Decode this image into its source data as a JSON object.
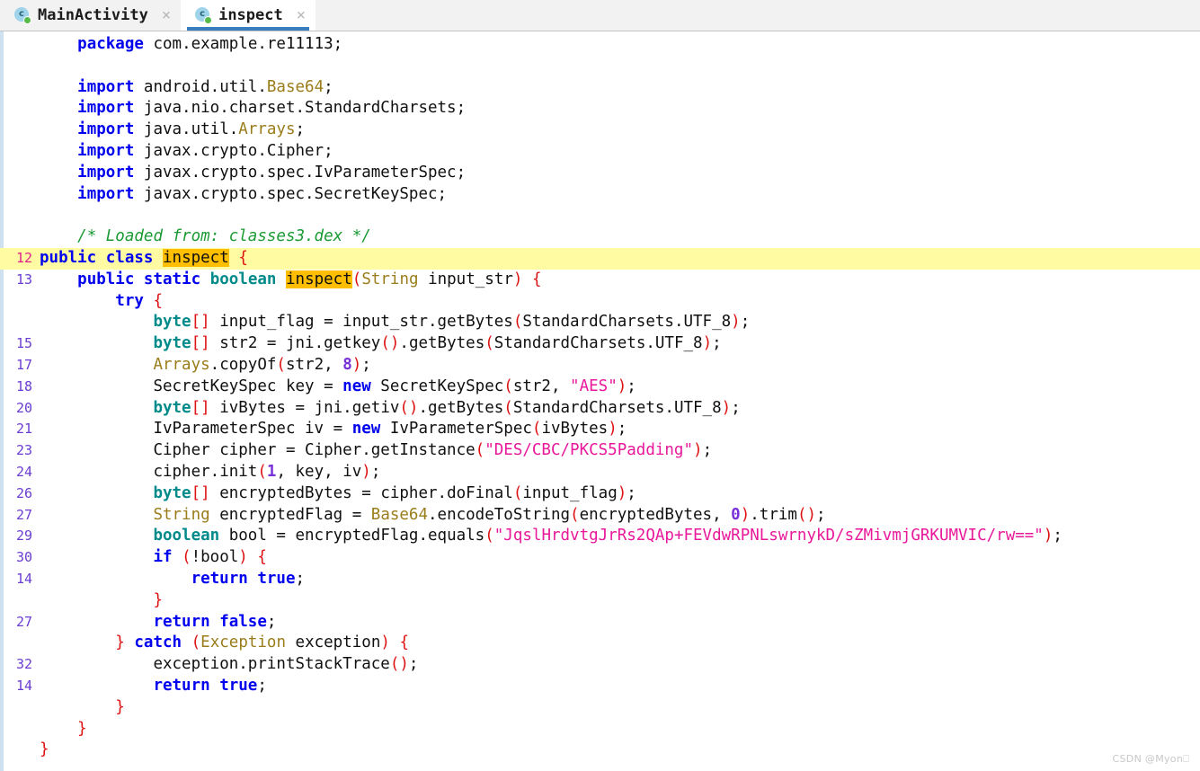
{
  "tabs": [
    {
      "label": "MainActivity",
      "icon": "java-class-icon",
      "close": "×",
      "active": false
    },
    {
      "label": "inspect",
      "icon": "java-class-icon",
      "close": "×",
      "active": true
    }
  ],
  "editor": {
    "highlighted_line_number": "12",
    "occurrence_term": "inspect",
    "watermark": "CSDN @Myon⎕",
    "lines": [
      {
        "num": "",
        "hl": false,
        "tokens": [
          {
            "t": "    ",
            "c": "id"
          },
          {
            "t": "package",
            "c": "kw"
          },
          {
            "t": " com.example.re11113",
            "c": "id"
          },
          {
            "t": ";",
            "c": "id"
          }
        ]
      },
      {
        "num": "",
        "hl": false,
        "tokens": []
      },
      {
        "num": "",
        "hl": false,
        "tokens": [
          {
            "t": "    ",
            "c": "id"
          },
          {
            "t": "import",
            "c": "kw"
          },
          {
            "t": " android.util.",
            "c": "id"
          },
          {
            "t": "Base64",
            "c": "cls"
          },
          {
            "t": ";",
            "c": "id"
          }
        ]
      },
      {
        "num": "",
        "hl": false,
        "tokens": [
          {
            "t": "    ",
            "c": "id"
          },
          {
            "t": "import",
            "c": "kw"
          },
          {
            "t": " java.nio.charset.StandardCharsets;",
            "c": "id"
          }
        ]
      },
      {
        "num": "",
        "hl": false,
        "tokens": [
          {
            "t": "    ",
            "c": "id"
          },
          {
            "t": "import",
            "c": "kw"
          },
          {
            "t": " java.util.",
            "c": "id"
          },
          {
            "t": "Arrays",
            "c": "cls"
          },
          {
            "t": ";",
            "c": "id"
          }
        ]
      },
      {
        "num": "",
        "hl": false,
        "tokens": [
          {
            "t": "    ",
            "c": "id"
          },
          {
            "t": "import",
            "c": "kw"
          },
          {
            "t": " javax.crypto.Cipher;",
            "c": "id"
          }
        ]
      },
      {
        "num": "",
        "hl": false,
        "tokens": [
          {
            "t": "    ",
            "c": "id"
          },
          {
            "t": "import",
            "c": "kw"
          },
          {
            "t": " javax.crypto.spec.IvParameterSpec;",
            "c": "id"
          }
        ]
      },
      {
        "num": "",
        "hl": false,
        "tokens": [
          {
            "t": "    ",
            "c": "id"
          },
          {
            "t": "import",
            "c": "kw"
          },
          {
            "t": " javax.crypto.spec.SecretKeySpec;",
            "c": "id"
          }
        ]
      },
      {
        "num": "",
        "hl": false,
        "tokens": []
      },
      {
        "num": "",
        "hl": false,
        "tokens": [
          {
            "t": "    ",
            "c": "id"
          },
          {
            "t": "/* Loaded from: classes3.dex */",
            "c": "cmt"
          }
        ]
      },
      {
        "num": "12",
        "hl": true,
        "tokens": [
          {
            "t": "public",
            "c": "kw"
          },
          {
            "t": " ",
            "c": "id"
          },
          {
            "t": "class",
            "c": "kw"
          },
          {
            "t": " ",
            "c": "id"
          },
          {
            "t": "|",
            "c": "caret"
          },
          {
            "t": "inspect",
            "c": "mark"
          },
          {
            "t": " ",
            "c": "id"
          },
          {
            "t": "{",
            "c": "pun"
          }
        ],
        "noindent": true
      },
      {
        "num": "13",
        "hl": false,
        "tokens": [
          {
            "t": "    ",
            "c": "id"
          },
          {
            "t": "public",
            "c": "kw"
          },
          {
            "t": " ",
            "c": "id"
          },
          {
            "t": "static",
            "c": "kw"
          },
          {
            "t": " ",
            "c": "id"
          },
          {
            "t": "boolean",
            "c": "typ"
          },
          {
            "t": " ",
            "c": "id"
          },
          {
            "t": "inspect",
            "c": "mark"
          },
          {
            "t": "(",
            "c": "pun"
          },
          {
            "t": "String",
            "c": "cls"
          },
          {
            "t": " input_str",
            "c": "id"
          },
          {
            "t": ")",
            "c": "pun"
          },
          {
            "t": " ",
            "c": "id"
          },
          {
            "t": "{",
            "c": "pun"
          }
        ]
      },
      {
        "num": "",
        "hl": false,
        "tokens": [
          {
            "t": "        ",
            "c": "id"
          },
          {
            "t": "try",
            "c": "kw"
          },
          {
            "t": " ",
            "c": "id"
          },
          {
            "t": "{",
            "c": "pun"
          }
        ]
      },
      {
        "num": "",
        "hl": false,
        "tokens": [
          {
            "t": "            ",
            "c": "id"
          },
          {
            "t": "byte",
            "c": "typ"
          },
          {
            "t": "[]",
            "c": "pun"
          },
          {
            "t": " input_flag = input_str.getBytes",
            "c": "id"
          },
          {
            "t": "(",
            "c": "pun"
          },
          {
            "t": "StandardCharsets.UTF_8",
            "c": "id"
          },
          {
            "t": ")",
            "c": "pun"
          },
          {
            "t": ";",
            "c": "id"
          }
        ]
      },
      {
        "num": "15",
        "hl": false,
        "tokens": [
          {
            "t": "            ",
            "c": "id"
          },
          {
            "t": "byte",
            "c": "typ"
          },
          {
            "t": "[]",
            "c": "pun"
          },
          {
            "t": " str2 = jni.getkey",
            "c": "id"
          },
          {
            "t": "()",
            "c": "pun"
          },
          {
            "t": ".getBytes",
            "c": "id"
          },
          {
            "t": "(",
            "c": "pun"
          },
          {
            "t": "StandardCharsets.UTF_8",
            "c": "id"
          },
          {
            "t": ")",
            "c": "pun"
          },
          {
            "t": ";",
            "c": "id"
          }
        ]
      },
      {
        "num": "17",
        "hl": false,
        "tokens": [
          {
            "t": "            ",
            "c": "id"
          },
          {
            "t": "Arrays",
            "c": "cls"
          },
          {
            "t": ".copyOf",
            "c": "id"
          },
          {
            "t": "(",
            "c": "pun"
          },
          {
            "t": "str2, ",
            "c": "id"
          },
          {
            "t": "8",
            "c": "num"
          },
          {
            "t": ")",
            "c": "pun"
          },
          {
            "t": ";",
            "c": "id"
          }
        ]
      },
      {
        "num": "18",
        "hl": false,
        "tokens": [
          {
            "t": "            ",
            "c": "id"
          },
          {
            "t": "SecretKeySpec key = ",
            "c": "id"
          },
          {
            "t": "new",
            "c": "kw"
          },
          {
            "t": " SecretKeySpec",
            "c": "id"
          },
          {
            "t": "(",
            "c": "pun"
          },
          {
            "t": "str2, ",
            "c": "id"
          },
          {
            "t": "\"AES\"",
            "c": "str"
          },
          {
            "t": ")",
            "c": "pun"
          },
          {
            "t": ";",
            "c": "id"
          }
        ]
      },
      {
        "num": "20",
        "hl": false,
        "tokens": [
          {
            "t": "            ",
            "c": "id"
          },
          {
            "t": "byte",
            "c": "typ"
          },
          {
            "t": "[]",
            "c": "pun"
          },
          {
            "t": " ivBytes = jni.getiv",
            "c": "id"
          },
          {
            "t": "()",
            "c": "pun"
          },
          {
            "t": ".getBytes",
            "c": "id"
          },
          {
            "t": "(",
            "c": "pun"
          },
          {
            "t": "StandardCharsets.UTF_8",
            "c": "id"
          },
          {
            "t": ")",
            "c": "pun"
          },
          {
            "t": ";",
            "c": "id"
          }
        ]
      },
      {
        "num": "21",
        "hl": false,
        "tokens": [
          {
            "t": "            ",
            "c": "id"
          },
          {
            "t": "IvParameterSpec iv = ",
            "c": "id"
          },
          {
            "t": "new",
            "c": "kw"
          },
          {
            "t": " IvParameterSpec",
            "c": "id"
          },
          {
            "t": "(",
            "c": "pun"
          },
          {
            "t": "ivBytes",
            "c": "id"
          },
          {
            "t": ")",
            "c": "pun"
          },
          {
            "t": ";",
            "c": "id"
          }
        ]
      },
      {
        "num": "23",
        "hl": false,
        "tokens": [
          {
            "t": "            ",
            "c": "id"
          },
          {
            "t": "Cipher cipher = Cipher.getInstance",
            "c": "id"
          },
          {
            "t": "(",
            "c": "pun"
          },
          {
            "t": "\"DES/CBC/PKCS5Padding\"",
            "c": "str"
          },
          {
            "t": ")",
            "c": "pun"
          },
          {
            "t": ";",
            "c": "id"
          }
        ]
      },
      {
        "num": "24",
        "hl": false,
        "tokens": [
          {
            "t": "            ",
            "c": "id"
          },
          {
            "t": "cipher.init",
            "c": "id"
          },
          {
            "t": "(",
            "c": "pun"
          },
          {
            "t": "1",
            "c": "num"
          },
          {
            "t": ", key, iv",
            "c": "id"
          },
          {
            "t": ")",
            "c": "pun"
          },
          {
            "t": ";",
            "c": "id"
          }
        ]
      },
      {
        "num": "26",
        "hl": false,
        "tokens": [
          {
            "t": "            ",
            "c": "id"
          },
          {
            "t": "byte",
            "c": "typ"
          },
          {
            "t": "[]",
            "c": "pun"
          },
          {
            "t": " encryptedBytes = cipher.doFinal",
            "c": "id"
          },
          {
            "t": "(",
            "c": "pun"
          },
          {
            "t": "input_flag",
            "c": "id"
          },
          {
            "t": ")",
            "c": "pun"
          },
          {
            "t": ";",
            "c": "id"
          }
        ]
      },
      {
        "num": "27",
        "hl": false,
        "tokens": [
          {
            "t": "            ",
            "c": "id"
          },
          {
            "t": "String",
            "c": "cls"
          },
          {
            "t": " encryptedFlag = ",
            "c": "id"
          },
          {
            "t": "Base64",
            "c": "cls"
          },
          {
            "t": ".encodeToString",
            "c": "id"
          },
          {
            "t": "(",
            "c": "pun"
          },
          {
            "t": "encryptedBytes, ",
            "c": "id"
          },
          {
            "t": "0",
            "c": "num"
          },
          {
            "t": ")",
            "c": "pun"
          },
          {
            "t": ".trim",
            "c": "id"
          },
          {
            "t": "()",
            "c": "pun"
          },
          {
            "t": ";",
            "c": "id"
          }
        ]
      },
      {
        "num": "29",
        "hl": false,
        "tokens": [
          {
            "t": "            ",
            "c": "id"
          },
          {
            "t": "boolean",
            "c": "typ"
          },
          {
            "t": " bool = encryptedFlag.equals",
            "c": "id"
          },
          {
            "t": "(",
            "c": "pun"
          },
          {
            "t": "\"JqslHrdvtgJrRs2QAp+FEVdwRPNLswrnykD/sZMivmjGRKUMVIC/rw==\"",
            "c": "str"
          },
          {
            "t": ")",
            "c": "pun"
          },
          {
            "t": ";",
            "c": "id"
          }
        ]
      },
      {
        "num": "30",
        "hl": false,
        "tokens": [
          {
            "t": "            ",
            "c": "id"
          },
          {
            "t": "if",
            "c": "kw"
          },
          {
            "t": " ",
            "c": "id"
          },
          {
            "t": "(",
            "c": "pun"
          },
          {
            "t": "!bool",
            "c": "id"
          },
          {
            "t": ")",
            "c": "pun"
          },
          {
            "t": " ",
            "c": "id"
          },
          {
            "t": "{",
            "c": "pun"
          }
        ]
      },
      {
        "num": "14",
        "hl": false,
        "tokens": [
          {
            "t": "                ",
            "c": "id"
          },
          {
            "t": "return",
            "c": "kw"
          },
          {
            "t": " ",
            "c": "id"
          },
          {
            "t": "true",
            "c": "kw"
          },
          {
            "t": ";",
            "c": "id"
          }
        ]
      },
      {
        "num": "",
        "hl": false,
        "tokens": [
          {
            "t": "            ",
            "c": "id"
          },
          {
            "t": "}",
            "c": "pun"
          }
        ]
      },
      {
        "num": "27",
        "hl": false,
        "tokens": [
          {
            "t": "            ",
            "c": "id"
          },
          {
            "t": "return",
            "c": "kw"
          },
          {
            "t": " ",
            "c": "id"
          },
          {
            "t": "false",
            "c": "kw"
          },
          {
            "t": ";",
            "c": "id"
          }
        ]
      },
      {
        "num": "",
        "hl": false,
        "tokens": [
          {
            "t": "        ",
            "c": "id"
          },
          {
            "t": "}",
            "c": "pun"
          },
          {
            "t": " ",
            "c": "id"
          },
          {
            "t": "catch",
            "c": "kw"
          },
          {
            "t": " ",
            "c": "id"
          },
          {
            "t": "(",
            "c": "pun"
          },
          {
            "t": "Exception",
            "c": "cls"
          },
          {
            "t": " exception",
            "c": "id"
          },
          {
            "t": ")",
            "c": "pun"
          },
          {
            "t": " ",
            "c": "id"
          },
          {
            "t": "{",
            "c": "pun"
          }
        ]
      },
      {
        "num": "32",
        "hl": false,
        "tokens": [
          {
            "t": "            ",
            "c": "id"
          },
          {
            "t": "exception.printStackTrace",
            "c": "id"
          },
          {
            "t": "()",
            "c": "pun"
          },
          {
            "t": ";",
            "c": "id"
          }
        ]
      },
      {
        "num": "14",
        "hl": false,
        "tokens": [
          {
            "t": "            ",
            "c": "id"
          },
          {
            "t": "return",
            "c": "kw"
          },
          {
            "t": " ",
            "c": "id"
          },
          {
            "t": "true",
            "c": "kw"
          },
          {
            "t": ";",
            "c": "id"
          }
        ]
      },
      {
        "num": "",
        "hl": false,
        "tokens": [
          {
            "t": "        ",
            "c": "id"
          },
          {
            "t": "}",
            "c": "pun"
          }
        ]
      },
      {
        "num": "",
        "hl": false,
        "tokens": [
          {
            "t": "    ",
            "c": "id"
          },
          {
            "t": "}",
            "c": "pun"
          }
        ]
      },
      {
        "num": "",
        "hl": false,
        "tokens": [
          {
            "t": "}",
            "c": "pun"
          }
        ]
      }
    ]
  },
  "colors": {
    "keyword": "#0000ee",
    "type": "#008a8a",
    "class": "#9a7d1a",
    "string": "#e8189a",
    "number": "#7a30d8",
    "punct": "#dd1111",
    "comment": "#1a9a33",
    "line_highlight": "#fffba3",
    "occurrence_highlight": "#ffbf00",
    "caret": "#e01010",
    "gutter": "#6a3dd0",
    "gutter_current": "#e0218a",
    "tab_active_underline": "#3a7cc0",
    "tabbar_bg": "#f2f2f2"
  }
}
